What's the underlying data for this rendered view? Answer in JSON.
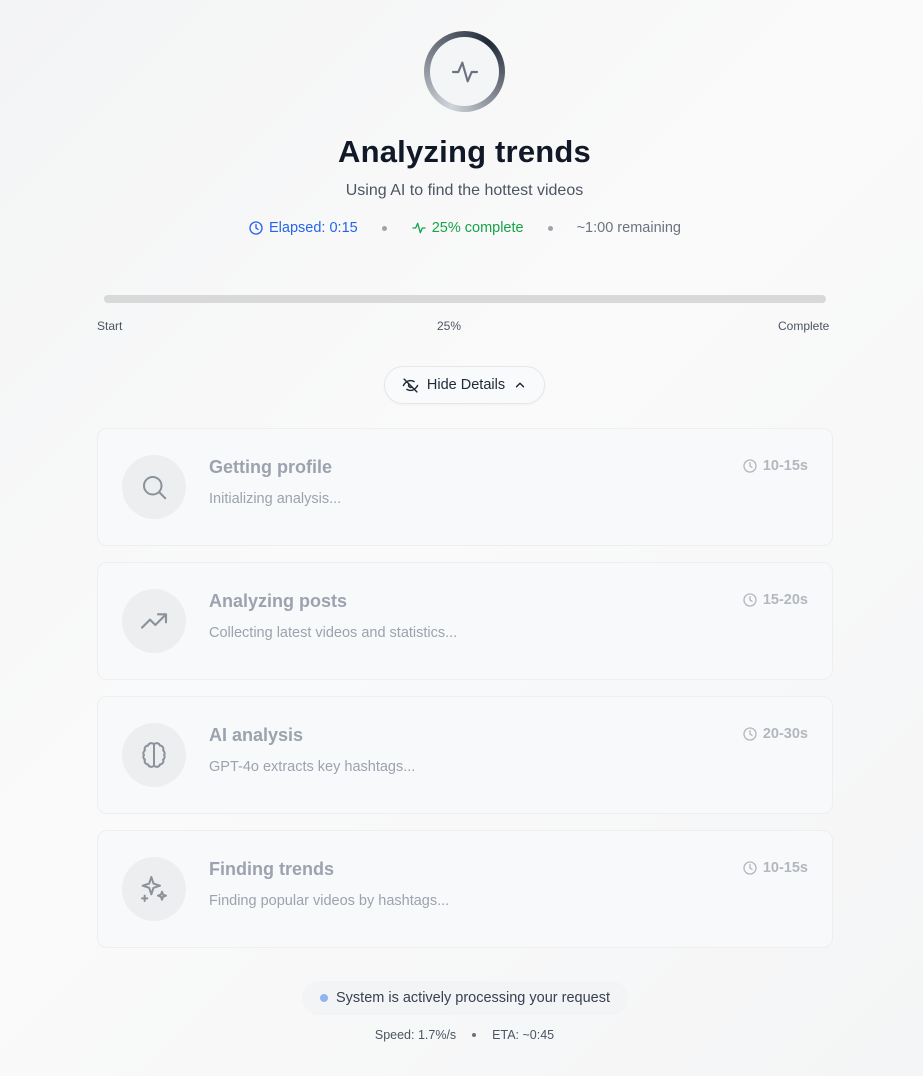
{
  "header": {
    "title": "Analyzing trends",
    "subtitle": "Using AI to find the hottest videos",
    "spinner_icon": "activity-icon"
  },
  "stats": {
    "elapsed_label": "Elapsed: 0:15",
    "percent_label": "25% complete",
    "remaining_label": "~1:00 remaining"
  },
  "progress": {
    "value_fraction": 0.25,
    "start_label": "Start",
    "value_label": "25%",
    "end_label": "Complete"
  },
  "toggle": {
    "label": "Hide Details"
  },
  "steps": [
    {
      "title": "Getting profile",
      "description": "Initializing analysis...",
      "time": "10-15s",
      "icon": "search-icon"
    },
    {
      "title": "Analyzing posts",
      "description": "Collecting latest videos and statistics...",
      "time": "15-20s",
      "icon": "trending-up-icon"
    },
    {
      "title": "AI analysis",
      "description": "GPT-4o extracts key hashtags...",
      "time": "20-30s",
      "icon": "brain-icon"
    },
    {
      "title": "Finding trends",
      "description": "Finding popular videos by hashtags...",
      "time": "10-15s",
      "icon": "sparkles-icon"
    }
  ],
  "status": {
    "message": "System is actively processing your request"
  },
  "footer": {
    "speed": "Speed: 1.7%/s",
    "eta": "ETA: ~0:45"
  },
  "colors": {
    "elapsed": "#2563eb",
    "complete": "#16a34a",
    "muted": "#9ca3af",
    "status_dot": "#93b4f0"
  }
}
